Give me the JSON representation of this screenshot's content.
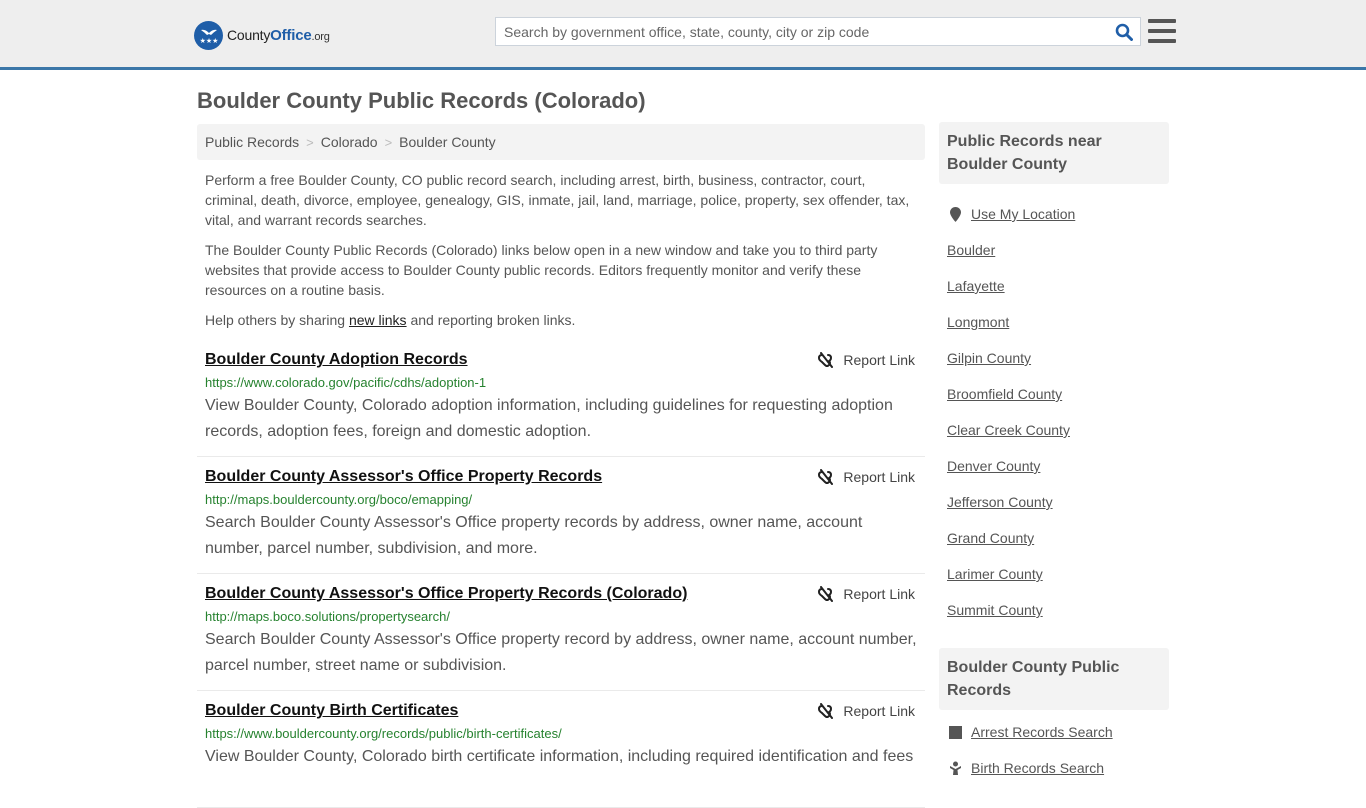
{
  "header": {
    "logo": {
      "part1": "County",
      "part2": "Office",
      "part3": ".org"
    },
    "search_placeholder": "Search by government office, state, county, city or zip code",
    "search_value": ""
  },
  "page": {
    "title": "Boulder County Public Records (Colorado)"
  },
  "breadcrumb": [
    {
      "label": "Public Records"
    },
    {
      "label": "Colorado"
    },
    {
      "label": "Boulder County"
    }
  ],
  "breadcrumb_separator": ">",
  "intro": {
    "p1": "Perform a free Boulder County, CO public record search, including arrest, birth, business, contractor, court, criminal, death, divorce, employee, genealogy, GIS, inmate, jail, land, marriage, police, property, sex offender, tax, vital, and warrant records searches.",
    "p2": "The Boulder County Public Records (Colorado) links below open in a new window and take you to third party websites that provide access to Boulder County public records. Editors frequently monitor and verify these resources on a routine basis.",
    "p3_before": "Help others by sharing ",
    "p3_link": "new links",
    "p3_after": " and reporting broken links."
  },
  "report_label": "Report Link",
  "records": [
    {
      "title": "Boulder County Adoption Records",
      "url": "https://www.colorado.gov/pacific/cdhs/adoption-1",
      "description": "View Boulder County, Colorado adoption information, including guidelines for requesting adoption records, adoption fees, foreign and domestic adoption."
    },
    {
      "title": "Boulder County Assessor's Office Property Records",
      "url": "http://maps.bouldercounty.org/boco/emapping/",
      "description": "Search Boulder County Assessor's Office property records by address, owner name, account number, parcel number, subdivision, and more."
    },
    {
      "title": "Boulder County Assessor's Office Property Records (Colorado)",
      "url": "http://maps.boco.solutions/propertysearch/",
      "description": "Search Boulder County Assessor's Office property record by address, owner name, account number, parcel number, street name or subdivision."
    },
    {
      "title": "Boulder County Birth Certificates",
      "url": "https://www.bouldercounty.org/records/public/birth-certificates/",
      "description": "View Boulder County, Colorado birth certificate information, including required identification and fees"
    }
  ],
  "sidebar": {
    "nearby_heading": "Public Records near Boulder County",
    "use_location": "Use My Location",
    "nearby": [
      "Boulder",
      "Lafayette",
      "Longmont",
      "Gilpin County",
      "Broomfield County",
      "Clear Creek County",
      "Denver County",
      "Jefferson County",
      "Grand County",
      "Larimer County",
      "Summit County"
    ],
    "county_heading": "Boulder County Public Records",
    "county_links": [
      {
        "label": "Arrest Records Search",
        "icon": "square-icon"
      },
      {
        "label": "Birth Records Search",
        "icon": "baby-icon"
      }
    ]
  },
  "colors": {
    "accent": "#3b77a8",
    "logo_blue": "#1f5ea8",
    "url_green": "#26822f",
    "text": "#555555",
    "panel_bg": "#f3f3f3"
  }
}
